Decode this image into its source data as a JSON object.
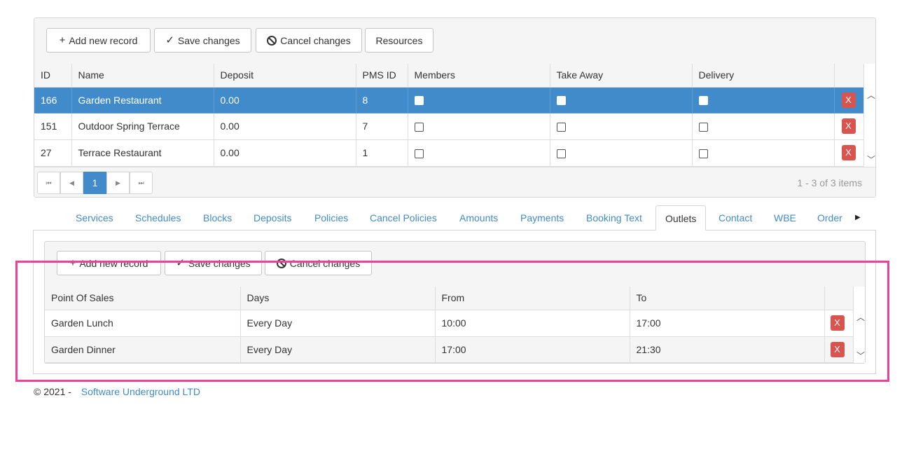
{
  "top_grid": {
    "toolbar": {
      "add_label": "Add new record",
      "save_label": "Save changes",
      "cancel_label": "Cancel changes",
      "resources_label": "Resources"
    },
    "columns": [
      "ID",
      "Name",
      "Deposit",
      "PMS ID",
      "Members",
      "Take Away",
      "Delivery"
    ],
    "rows": [
      {
        "id": "166",
        "name": "Garden Restaurant",
        "deposit": "0.00",
        "pms_id": "8",
        "members": false,
        "take_away": false,
        "delivery": false,
        "selected": true
      },
      {
        "id": "151",
        "name": "Outdoor Spring Terrace",
        "deposit": "0.00",
        "pms_id": "7",
        "members": false,
        "take_away": false,
        "delivery": false,
        "selected": false
      },
      {
        "id": "27",
        "name": "Terrace Restaurant",
        "deposit": "0.00",
        "pms_id": "1",
        "members": false,
        "take_away": false,
        "delivery": false,
        "selected": false
      }
    ],
    "delete_label": "X",
    "pager": {
      "current_page": "1",
      "info": "1 - 3 of 3 items"
    }
  },
  "tabs": [
    {
      "label": "Services",
      "active": false
    },
    {
      "label": "Schedules",
      "active": false
    },
    {
      "label": "Blocks",
      "active": false
    },
    {
      "label": "Deposits",
      "active": false
    },
    {
      "label": "Policies",
      "active": false
    },
    {
      "label": "Cancel Policies",
      "active": false
    },
    {
      "label": "Amounts",
      "active": false
    },
    {
      "label": "Payments",
      "active": false
    },
    {
      "label": "Booking Text",
      "active": false
    },
    {
      "label": "Outlets",
      "active": true
    },
    {
      "label": "Contact",
      "active": false
    },
    {
      "label": "WBE",
      "active": false
    },
    {
      "label": "Order",
      "active": false
    }
  ],
  "outlets_grid": {
    "toolbar": {
      "add_label": "Add new record",
      "save_label": "Save changes",
      "cancel_label": "Cancel changes"
    },
    "columns": [
      "Point Of Sales",
      "Days",
      "From",
      "To"
    ],
    "rows": [
      {
        "point_of_sales": "Garden Lunch",
        "days": "Every Day",
        "from": "10:00",
        "to": "17:00"
      },
      {
        "point_of_sales": "Garden Dinner",
        "days": "Every Day",
        "from": "17:00",
        "to": "21:30"
      }
    ],
    "delete_label": "X"
  },
  "footer": {
    "copyright": "© 2021 -",
    "link": "Software Underground LTD"
  },
  "colors": {
    "accent": "#428bca",
    "danger": "#d9534f",
    "highlight": "#e8449a"
  }
}
